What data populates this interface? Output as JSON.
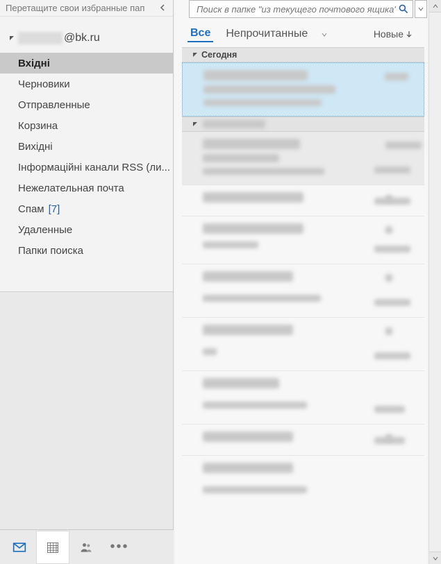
{
  "favorites_hint": "Перетащите свои избранные пап",
  "account": {
    "domain": "@bk.ru"
  },
  "folders": [
    {
      "label": "Вхідні",
      "selected": true
    },
    {
      "label": "Черновики"
    },
    {
      "label": "Отправленные"
    },
    {
      "label": "Корзина"
    },
    {
      "label": "Вихідні"
    },
    {
      "label": "Інформаційні канали RSS (ли..."
    },
    {
      "label": "Нежелательная почта"
    },
    {
      "label": "Спам",
      "badge": "[7]"
    },
    {
      "label": "Удаленные"
    },
    {
      "label": "Папки поиска"
    }
  ],
  "search": {
    "placeholder": "Поиск в папке \"из текущего почтового ящика\" ("
  },
  "filter": {
    "all": "Все",
    "unread": "Непрочитанные",
    "sort_label": "Новые"
  },
  "group_today": "Сегодня"
}
